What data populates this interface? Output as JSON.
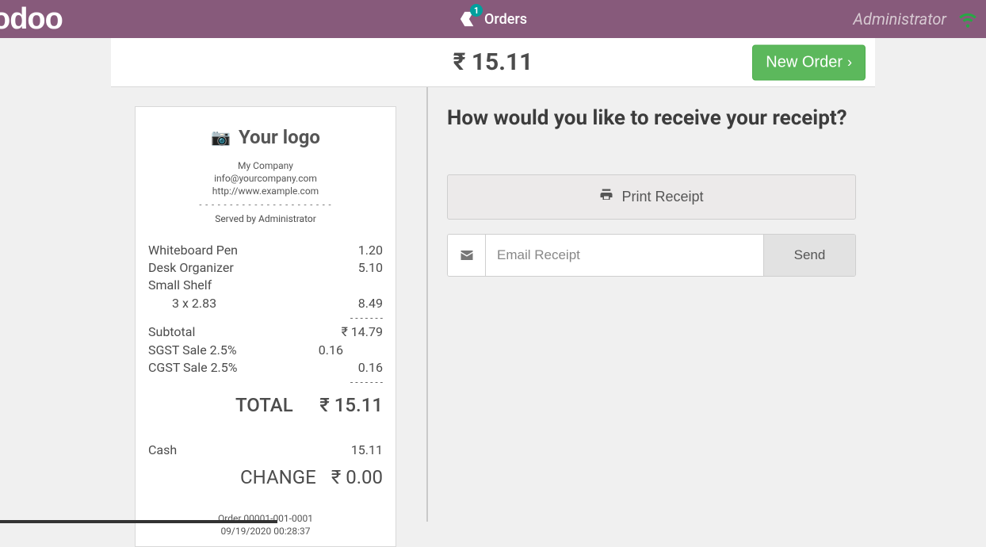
{
  "topbar": {
    "brand": "odoo",
    "orders_label": "Orders",
    "orders_count": "1",
    "user": "Administrator"
  },
  "header": {
    "total": "₹ 15.11",
    "new_order_label": "New Order"
  },
  "receipt": {
    "logo_text": "Your logo",
    "company": "My Company",
    "email": "info@yourcompany.com",
    "website": "http://www.example.com",
    "served_by": "Served by Administrator",
    "lines": [
      {
        "name": "Whiteboard Pen",
        "qty": "",
        "price": "1.20"
      },
      {
        "name": "Desk Organizer",
        "qty": "",
        "price": "5.10"
      },
      {
        "name": "Small Shelf",
        "qty": "3 x 2.83",
        "price": "8.49"
      }
    ],
    "subtotal_label": "Subtotal",
    "subtotal": "₹ 14.79",
    "taxes": [
      {
        "label": "SGST Sale 2.5%",
        "value": "0.16"
      },
      {
        "label": "CGST Sale 2.5%",
        "value": "0.16"
      }
    ],
    "total_label": "TOTAL",
    "total": "₹ 15.11",
    "payment_label": "Cash",
    "payment_value": "15.11",
    "change_label": "CHANGE",
    "change_value": "₹ 0.00",
    "order_ref": "Order 00001-001-0001",
    "order_date": "09/19/2020 00:28:37"
  },
  "right": {
    "question": "How would you like to receive your receipt?",
    "print_label": "Print Receipt",
    "email_placeholder": "Email Receipt",
    "send_label": "Send"
  }
}
